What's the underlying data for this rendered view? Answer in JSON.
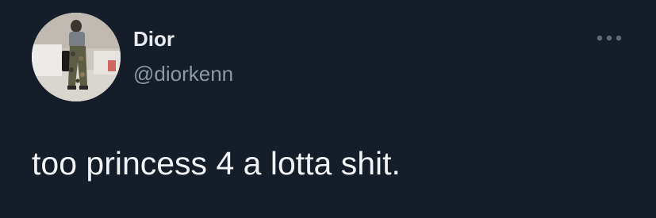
{
  "tweet": {
    "author": {
      "display_name": "Dior",
      "handle": "@diorkenn",
      "avatar_icon": "profile-photo"
    },
    "more_icon": "ellipsis-icon",
    "text": "too princess 4 a lotta shit."
  },
  "colors": {
    "background": "#151d28",
    "name": "#e8eaed",
    "handle": "#8b98a5",
    "text": "#f0f2f4",
    "more_icon": "#5f6b77"
  }
}
